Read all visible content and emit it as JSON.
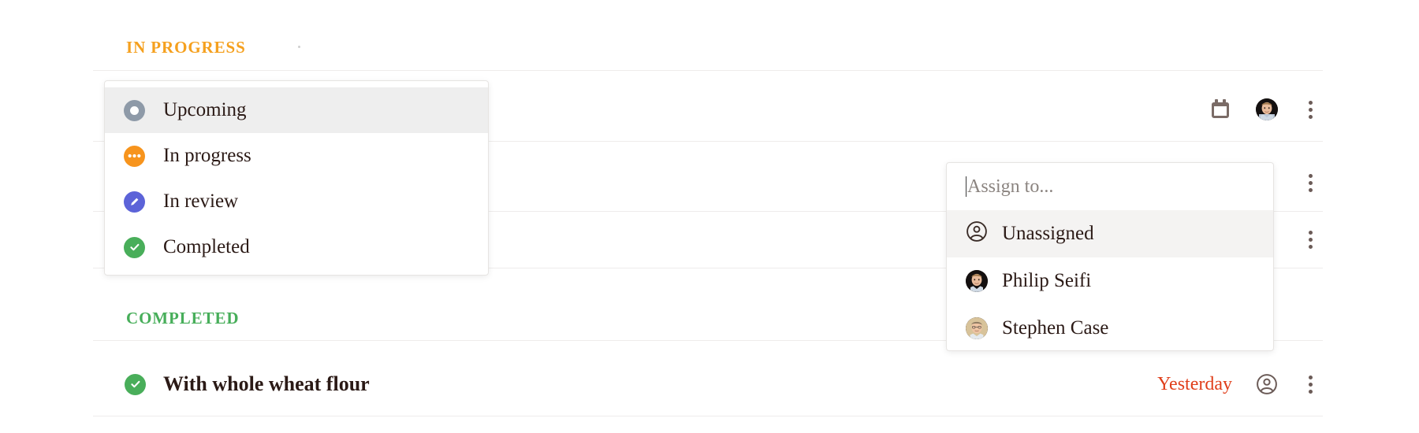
{
  "sections": [
    {
      "id": "in-progress",
      "label": "IN PROGRESS",
      "color": "#F5A01E"
    },
    {
      "id": "completed",
      "label": "COMPLETED",
      "color": "#47AE5A"
    }
  ],
  "status_popup": {
    "name": "status-dropdown",
    "items": [
      {
        "label": "Upcoming",
        "icon": "circle-outline-icon",
        "color": "#8E9AA8",
        "selected": true
      },
      {
        "label": "In progress",
        "icon": "ellipsis-circle-icon",
        "color": "#F7941D",
        "selected": false
      },
      {
        "label": "In review",
        "icon": "pencil-circle-icon",
        "color": "#5C63D8",
        "selected": false
      },
      {
        "label": "Completed",
        "icon": "check-circle-icon",
        "color": "#49AE5A",
        "selected": false
      }
    ]
  },
  "assign_popup": {
    "name": "assign-dropdown",
    "input_value": "",
    "placeholder": "Assign to...",
    "items": [
      {
        "label": "Unassigned",
        "icon": "account-circle-icon",
        "highlight": true
      },
      {
        "label": "Philip Seifi",
        "icon": "avatar-philip",
        "highlight": false
      },
      {
        "label": "Stephen Case",
        "icon": "avatar-stephen",
        "highlight": false
      }
    ]
  },
  "rows": [
    {
      "id": "row-1",
      "icons": [
        "calendar-icon",
        "avatar-philip",
        "kebab-menu-icon"
      ]
    },
    {
      "id": "row-2",
      "icons": [
        "kebab-menu-icon"
      ]
    },
    {
      "id": "row-3",
      "icons": [
        "kebab-menu-icon"
      ]
    }
  ],
  "completed_task": {
    "status_icon": "check-circle-icon",
    "status_color": "#49AE5A",
    "title": "With whole wheat flour",
    "due": "Yesterday",
    "due_color": "#E03E1A",
    "assignee_icon": "account-circle-icon",
    "menu_icon": "kebab-menu-icon"
  }
}
